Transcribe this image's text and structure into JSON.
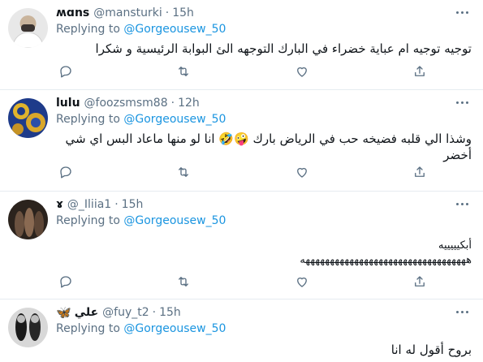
{
  "tweets": [
    {
      "name": "ʍɑns",
      "handle": "@mansturki",
      "time": "15h",
      "replying_prefix": "Replying to ",
      "replying_to": "@Gorgeousew_50",
      "text": "توجيه توجيه ام عباية خضراء في البارك التوجهه الئ البوابة الرئيسية و شكرا"
    },
    {
      "name": "lulu",
      "handle": "@foozsmsm88",
      "time": "12h",
      "replying_prefix": "Replying to ",
      "replying_to": "@Gorgeousew_50",
      "text_line1": "وشذا الي قلبه فضيخه حب في الرياض بارك 🤪🤣 انا لو منها ماعاد البس اي شي",
      "text_line2": "أخضر"
    },
    {
      "name": "ɤ",
      "handle": "@_Iliia1",
      "time": "15h",
      "replying_prefix": "Replying to ",
      "replying_to": "@Gorgeousew_50",
      "text_line1": "أبكيييييه",
      "text_line2": "ههههههههههههههههههههههههههههههههههه"
    },
    {
      "name": "علي",
      "badge": "🦋",
      "handle": "@fuy_t2",
      "time": "15h",
      "replying_prefix": "Replying to ",
      "replying_to": "@Gorgeousew_50",
      "text": "بروح أقول له انا"
    }
  ],
  "separator": "·"
}
